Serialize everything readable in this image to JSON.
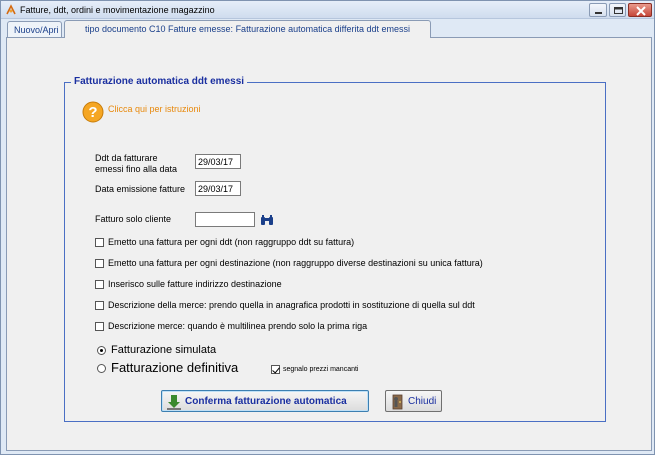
{
  "window": {
    "title": "Fatture, ddt, ordini e movimentazione magazzino"
  },
  "tabs": [
    {
      "label": "Nuovo/Apri"
    },
    {
      "label": "tipo documento C10 Fatture emesse: Fatturazione automatica differita ddt emessi"
    }
  ],
  "group": {
    "title": "Fatturazione automatica ddt emessi"
  },
  "help": {
    "link_text": "Clicca qui per istruzioni"
  },
  "fields": {
    "ddt_label_line1": "Ddt da fatturare",
    "ddt_label_line2": "emessi fino alla data",
    "ddt_date": "29/03/17",
    "emission_label": "Data emissione fatture",
    "emission_date": "29/03/17",
    "client_label": "Fatturo solo cliente",
    "client_value": ""
  },
  "options": [
    {
      "label": "Emetto una fattura per ogni ddt (non raggruppo ddt su fattura)",
      "checked": false
    },
    {
      "label": "Emetto una fattura per ogni destinazione (non raggruppo diverse destinazioni su unica fattura)",
      "checked": false
    },
    {
      "label": "Inserisco sulle fatture indirizzo destinazione",
      "checked": false
    },
    {
      "label": "Descrizione della merce: prendo quella in anagrafica prodotti in sostituzione di quella sul ddt",
      "checked": false
    },
    {
      "label": "Descrizione merce: quando è multilinea prendo solo la prima riga",
      "checked": false
    }
  ],
  "mode": {
    "simulated_label": "Fatturazione simulata",
    "definitive_label": "Fatturazione definitiva",
    "selected": "simulated",
    "missing_prices_label": "segnalo prezzi mancanti",
    "missing_prices_checked": true
  },
  "buttons": {
    "confirm": "Conferma fatturazione automatica",
    "close": "Chiudi"
  },
  "colors": {
    "group_title": "#1a2fa0",
    "help_link": "#e8890c",
    "group_border": "#4a6fc4"
  }
}
